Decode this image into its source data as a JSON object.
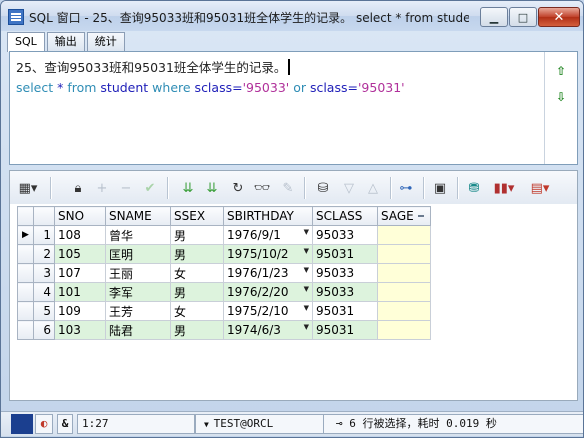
{
  "window": {
    "title": "SQL 窗口 - 25、查询95033班和95031班全体学生的记录。 select * from stude..."
  },
  "tabs": [
    "SQL",
    "输出",
    "统计"
  ],
  "editor": {
    "comment": "25、查询95033班和95031班全体学生的记录。",
    "sql": {
      "kw1": "select",
      "star": " * ",
      "kw2": "from",
      "t1": " student ",
      "kw3": "where",
      "t2": " sclass=",
      "s1": "'95033'",
      "kw4": " or ",
      "t3": "sclass=",
      "s2": "'95031'"
    }
  },
  "grid": {
    "columns": [
      "SNO",
      "SNAME",
      "SSEX",
      "SBIRTHDAY",
      "SCLASS",
      "SAGE"
    ],
    "rows": [
      {
        "n": "1",
        "sno": "108",
        "sname": "曾华",
        "ssex": "男",
        "sbirthday": "1976/9/1",
        "sclass": "95033",
        "sage": ""
      },
      {
        "n": "2",
        "sno": "105",
        "sname": "匡明",
        "ssex": "男",
        "sbirthday": "1975/10/2",
        "sclass": "95031",
        "sage": ""
      },
      {
        "n": "3",
        "sno": "107",
        "sname": "王丽",
        "ssex": "女",
        "sbirthday": "1976/1/23",
        "sclass": "95033",
        "sage": ""
      },
      {
        "n": "4",
        "sno": "101",
        "sname": "李军",
        "ssex": "男",
        "sbirthday": "1976/2/20",
        "sclass": "95033",
        "sage": ""
      },
      {
        "n": "5",
        "sno": "109",
        "sname": "王芳",
        "ssex": "女",
        "sbirthday": "1975/2/10",
        "sclass": "95031",
        "sage": ""
      },
      {
        "n": "6",
        "sno": "103",
        "sname": "陆君",
        "ssex": "男",
        "sbirthday": "1974/6/3",
        "sclass": "95031",
        "sage": ""
      }
    ]
  },
  "status": {
    "position": "1:27",
    "connection": "TEST@ORCL",
    "message": "6 行被选择，耗时 0.019 秒"
  },
  "colors": {
    "even_row": "#ddf3dd",
    "sage_col": "#ffffd8",
    "keyword": "#2f8db5",
    "string": "#b0309a"
  }
}
